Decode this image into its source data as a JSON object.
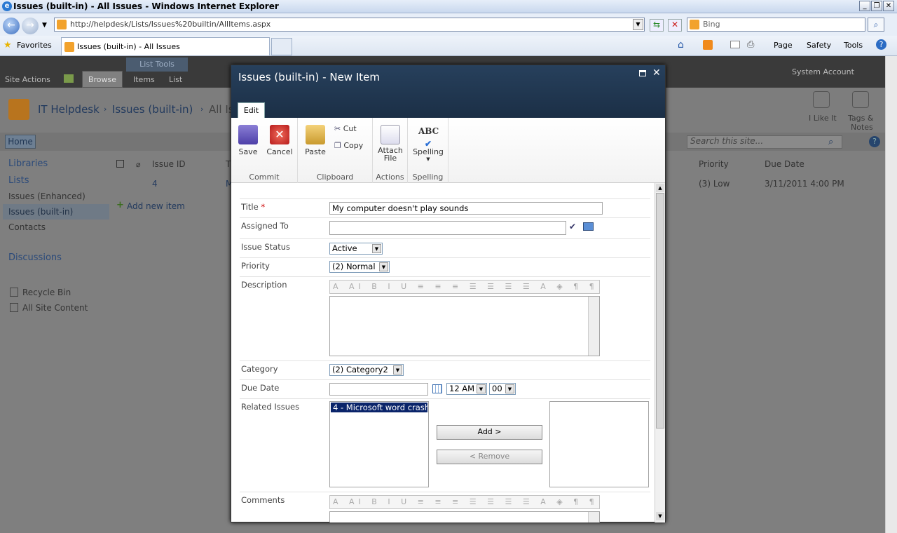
{
  "window": {
    "title": "Issues (built-in) - All Issues - Windows Internet Explorer",
    "address": "http://helpdesk/Lists/Issues%20builtin/AllItems.aspx",
    "search_placeholder": "Bing",
    "favorites": "Favorites",
    "tab_title": "Issues (built-in) - All Issues",
    "commands": [
      "Page",
      "Safety",
      "Tools"
    ]
  },
  "sharepoint": {
    "site_actions": "Site Actions",
    "browse": "Browse",
    "list_tools": "List Tools",
    "items": "Items",
    "list": "List",
    "system_account": "System Account",
    "site_title": "IT Helpdesk",
    "crumb_list": "Issues (built-in)",
    "crumb_view": "All Is",
    "i_like_it": "I Like It",
    "tags_notes": "Tags &",
    "tags_notes_2": "Notes",
    "home": "Home",
    "search_placeholder": "Search this site...",
    "nav": {
      "libraries": "Libraries",
      "lists": "Lists",
      "issues_enhanced": "Issues (Enhanced)",
      "issues_builtin": "Issues (built-in)",
      "contacts": "Contacts",
      "discussions": "Discussions",
      "recycle_bin": "Recycle Bin",
      "all_site_content": "All Site Content"
    },
    "table": {
      "issue_id_header": "Issue ID",
      "col_t": "T",
      "priority_header": "Priority",
      "due_date_header": "Due Date",
      "row_id": "4",
      "row_m": "M",
      "row_priority": "(3) Low",
      "row_due": "3/11/2011 4:00 PM",
      "add_new": "Add new item"
    }
  },
  "dialog": {
    "title": "Issues (built-in) - New Item",
    "edit_tab": "Edit",
    "ribbon": {
      "save": "Save",
      "cancel": "Cancel",
      "paste": "Paste",
      "cut": "Cut",
      "copy": "Copy",
      "attach": "Attach",
      "attach2": "File",
      "spelling": "Spelling",
      "groups": [
        "Commit",
        "Clipboard",
        "Actions",
        "Spelling"
      ]
    },
    "fields": {
      "title_label": "Title",
      "title_value": "My computer doesn't play sounds",
      "assigned_label": "Assigned To",
      "status_label": "Issue Status",
      "status_value": "Active",
      "priority_label": "Priority",
      "priority_value": "(2) Normal",
      "description_label": "Description",
      "category_label": "Category",
      "category_value": "(2) Category2",
      "due_label": "Due Date",
      "hour_value": "12 AM",
      "minute_value": "00",
      "related_label": "Related Issues",
      "related_option": "4 - Microsoft word crash",
      "add_button": "Add >",
      "remove_button": "< Remove",
      "comments_label": "Comments"
    },
    "rich_toolbar": "A AI B I U ≡ ≡ ≡ ☰ ☰ ☰ ☰ A ◈ ¶ ¶"
  }
}
